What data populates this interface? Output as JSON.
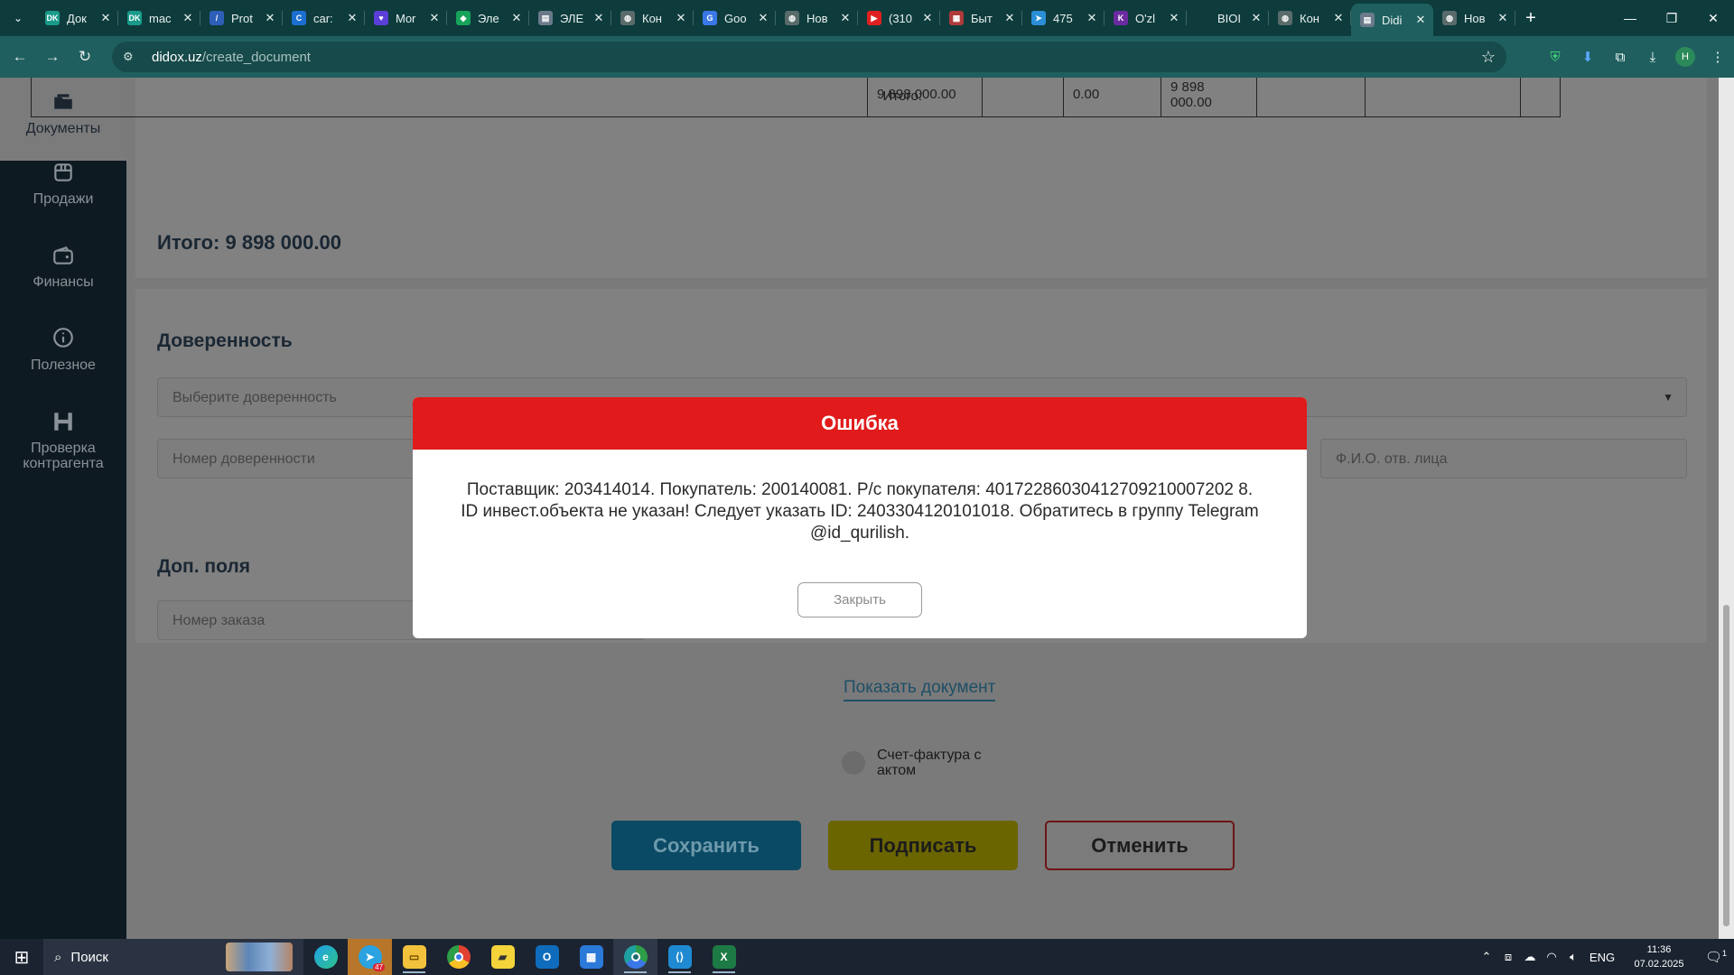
{
  "browser": {
    "tabs": [
      {
        "title": "Док",
        "color": "#1a9a8a",
        "glyph": "DK"
      },
      {
        "title": "mac",
        "color": "#1a9a8a",
        "glyph": "DK"
      },
      {
        "title": "Prot",
        "color": "#2d5fb8",
        "glyph": "/"
      },
      {
        "title": "car:",
        "color": "#1c6fd0",
        "glyph": "C"
      },
      {
        "title": "Mor",
        "color": "#5b3fd8",
        "glyph": "♥"
      },
      {
        "title": "Эле",
        "color": "#17a35a",
        "glyph": "◆"
      },
      {
        "title": "ЭЛЕ",
        "color": "#6a7a8a",
        "glyph": "▤"
      },
      {
        "title": "Кон",
        "color": "#5a6b6b",
        "glyph": "◍"
      },
      {
        "title": "Goo",
        "color": "#3b78e7",
        "glyph": "G"
      },
      {
        "title": "Нов",
        "color": "#5a6b6b",
        "glyph": "◍"
      },
      {
        "title": "(310",
        "color": "#e02020",
        "glyph": "▶"
      },
      {
        "title": "Быт",
        "color": "#b03a3a",
        "glyph": "▦"
      },
      {
        "title": "475",
        "color": "#2a8fd6",
        "glyph": "➤"
      },
      {
        "title": "O'zl",
        "color": "#6a2aa0",
        "glyph": "K"
      },
      {
        "title": "BIOI",
        "color": "#0e3c3c",
        "glyph": ""
      },
      {
        "title": "Кон",
        "color": "#5a6b6b",
        "glyph": "◍"
      },
      {
        "title": "Didi",
        "color": "#6a7a8a",
        "glyph": "▤",
        "active": true
      },
      {
        "title": "Нов",
        "color": "#5a6b6b",
        "glyph": "◍"
      }
    ],
    "url_host": "didox.uz",
    "url_path": "/create_document"
  },
  "sidebar": {
    "items": [
      {
        "label": "Документы",
        "icon": "folder-icon"
      },
      {
        "label": "Продажи",
        "icon": "store-icon"
      },
      {
        "label": "Финансы",
        "icon": "wallet-icon"
      },
      {
        "label": "Полезное",
        "icon": "info-icon"
      },
      {
        "label": "Проверка контрагента",
        "icon": "h-logo-icon"
      }
    ]
  },
  "table_totals": {
    "label": "Итого:",
    "sum": "9 898 000.00",
    "vat": "0.00",
    "total": "9 898 000.00"
  },
  "total_line": "Итого: 9 898 000.00",
  "poa_section": {
    "title": "Доверенность",
    "select_placeholder": "Выберите доверенность",
    "number_placeholder": "Номер доверенности",
    "person_placeholder": "Ф.И.О. отв. лица"
  },
  "extra_section": {
    "title": "Доп. поля",
    "order_placeholder": "Номер заказа"
  },
  "show_document": "Показать документ",
  "invoice_act_label": "Счет-фактура с актом",
  "buttons": {
    "save": "Сохранить",
    "sign": "Подписать",
    "cancel": "Отменить"
  },
  "modal": {
    "title": "Ошибка",
    "message": "Поставщик: 203414014. Покупатель: 200140081. Р/с покупателя: 40172286030412709210007202 8. ID инвест.объекта не указан! Следует указать ID: 2403304120101018. Обратитесь в группу Telegram @id_qurilish.",
    "close": "Закрыть"
  },
  "taskbar": {
    "search": "Поиск",
    "telegram_badge": "47",
    "lang": "ENG",
    "time": "11:36",
    "date": "07.02.2025",
    "notif_count": "1"
  }
}
